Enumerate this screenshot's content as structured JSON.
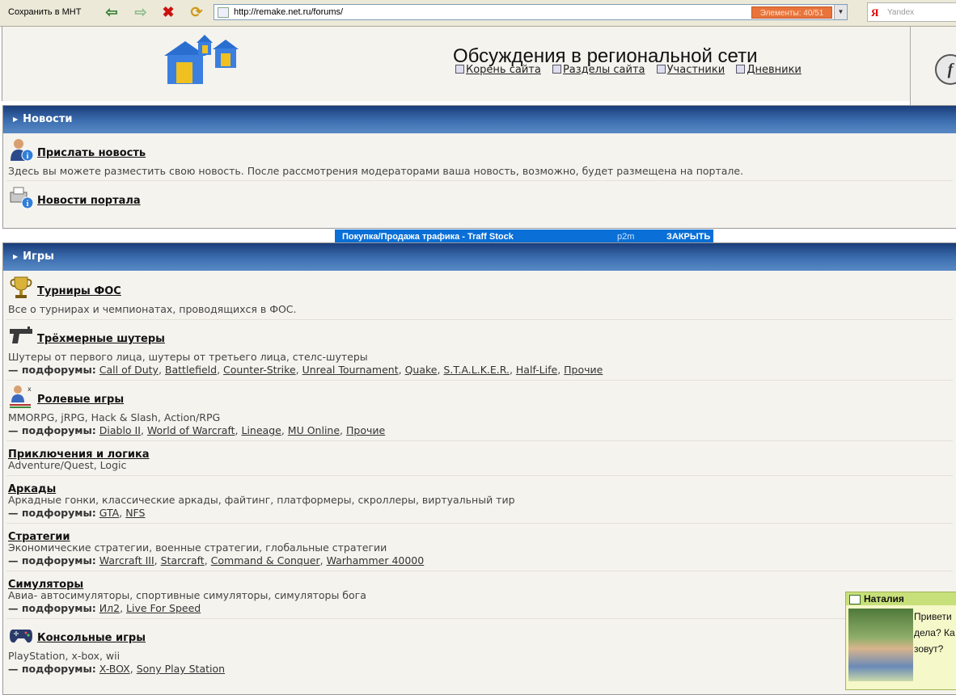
{
  "browser": {
    "save_label": "Сохранить в МНТ",
    "url": "http://remake.net.ru/forums/",
    "badge": "Элементы: 40/51",
    "search_placeholder": "Yandex",
    "search_logo": "Я"
  },
  "header": {
    "title": "Обсуждения в региональной сети",
    "nav": [
      "Корень сайта",
      "Разделы сайта",
      "Участники",
      "Дневники"
    ]
  },
  "news": {
    "heading": "Новости",
    "forums": [
      {
        "title": "Прислать новость",
        "desc": "Здесь вы можете разместить свою новость. После рассмотрения модераторами ваша новость, возможно, будет размещена на портале.",
        "icon": "user-info-icon"
      },
      {
        "title": "Новости портала",
        "desc": "",
        "icon": "printer-info-icon"
      }
    ]
  },
  "ad": {
    "text": "Покупка/Продажа трафика - Traff Stock",
    "tag": "p2m",
    "close": "ЗАКРЫТЬ"
  },
  "games": {
    "heading": "Игры",
    "subforums_label": "— подфорумы:",
    "forums": [
      {
        "title": "Турниры ФОС",
        "desc": "Все о турнирах и чемпионатах, проводящихся в ФОС.",
        "subforums": []
      },
      {
        "title": "Трёхмерные шутеры",
        "desc": "Шутеры от первого лица, шутеры от третьего лица, стелс-шутеры",
        "subforums": [
          "Call of Duty",
          "Battlefield",
          "Counter-Strike",
          "Unreal Tournament",
          "Quake",
          "S.T.A.L.K.E.R.",
          "Half-Life",
          "Прочие"
        ]
      },
      {
        "title": "Ролевые игры",
        "desc": "MMORPG, jRPG, Hack & Slash, Action/RPG",
        "subforums": [
          "Diablo II",
          "World of Warcraft",
          "Lineage",
          "MU Online",
          "Прочие"
        ]
      },
      {
        "title": "Приключения и логика",
        "desc": "Adventure/Quest, Logic",
        "subforums": []
      },
      {
        "title": "Аркады",
        "desc": "Аркадные гонки, классические аркады, файтинг, платформеры, скроллеры, виртуальный тир",
        "subforums": [
          "GTA",
          "NFS"
        ]
      },
      {
        "title": "Стратегии",
        "desc": "Экономические стратегии, военные стратегии, глобальные стратегии",
        "subforums": [
          "Warcraft III",
          "Starcraft",
          "Command & Conquer",
          "Warhammer 40000"
        ]
      },
      {
        "title": "Симуляторы",
        "desc": "Авиа- автосимуляторы, спортивные симуляторы, симуляторы бога",
        "subforums": [
          "Ил2",
          "Live For Speed"
        ]
      },
      {
        "title": "Консольные игры",
        "desc": "PlayStation, x-box, wii",
        "subforums": [
          "X-BOX",
          "Sony Play Station"
        ]
      }
    ]
  },
  "chat": {
    "name": "Наталия",
    "lines": [
      "Привети",
      "дела? Ка",
      "зовут?"
    ]
  }
}
